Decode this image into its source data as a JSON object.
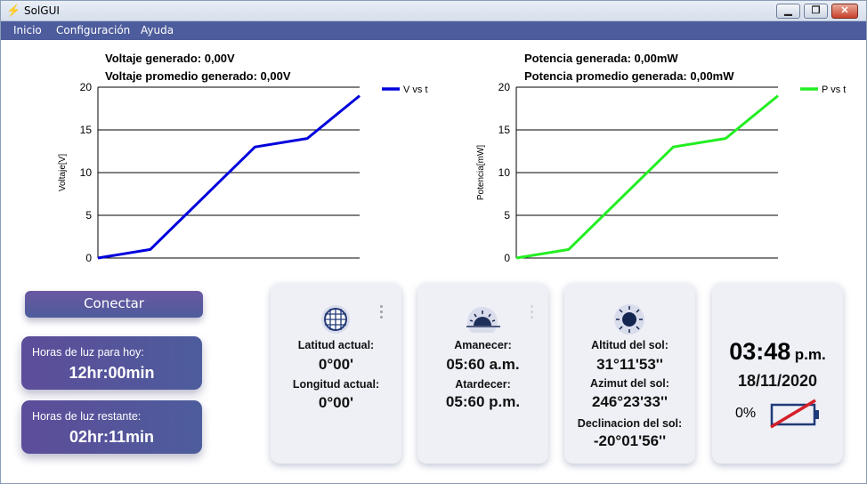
{
  "window": {
    "title": "SolGUI",
    "controls": {
      "minimize": "▁",
      "maximize": "❐",
      "close": "✕"
    }
  },
  "menu": [
    "Inicio",
    "Configuración",
    "Ayuda"
  ],
  "voltage": {
    "generated": "Voltaje generado: 0,00V",
    "average": "Voltaje promedio generado: 0,00V"
  },
  "power": {
    "generated": "Potencia generada: 0,00mW",
    "average": "Potencia promedio generada: 0,00mW"
  },
  "chart_data": [
    {
      "type": "line",
      "ylabel": "Voltaje[V]",
      "ylim": [
        0,
        20
      ],
      "yticks": [
        0,
        5,
        10,
        15,
        20
      ],
      "grid": true,
      "legend": "top-right",
      "series": [
        {
          "name": "V vs t",
          "color": "#0000dd",
          "x": [
            0,
            1,
            2,
            3,
            4,
            5
          ],
          "y": [
            0,
            1,
            7,
            13,
            14,
            19
          ]
        }
      ]
    },
    {
      "type": "line",
      "ylabel": "Potencia[mW]",
      "ylim": [
        0,
        20
      ],
      "yticks": [
        0,
        5,
        10,
        15,
        20
      ],
      "grid": true,
      "legend": "top-right",
      "series": [
        {
          "name": "P vs t",
          "color": "#22ee22",
          "x": [
            0,
            1,
            2,
            3,
            4,
            5
          ],
          "y": [
            0,
            1,
            7,
            13,
            14,
            19
          ]
        }
      ]
    }
  ],
  "controls": {
    "connect": "Conectar",
    "daylight_today_label": "Horas de luz para hoy:",
    "daylight_today_value": "12hr:00min",
    "daylight_left_label": "Horas de luz restante:",
    "daylight_left_value": "02hr:11min"
  },
  "location": {
    "lat_label": "Latitud actual:",
    "lat_value": "0°00'",
    "lon_label": "Longitud actual:",
    "lon_value": "0°00'"
  },
  "sun_times": {
    "sunrise_label": "Amanecer:",
    "sunrise_value": "05:60 a.m.",
    "sunset_label": "Atardecer:",
    "sunset_value": "05:60 p.m."
  },
  "sun_position": {
    "altitude_label": "Altitud del sol:",
    "altitude_value": "31°11'53''",
    "azimuth_label": "Azimut del sol:",
    "azimuth_value": "246°23'33''",
    "declination_label": "Declinacion del sol:",
    "declination_value": "-20°01'56''"
  },
  "clock": {
    "time": "03:48",
    "ampm": "p.m.",
    "date": "18/11/2020",
    "battery": "0%"
  },
  "colors": {
    "menu": "#4d5c9c",
    "card_gradient_start": "#5d4d9a",
    "battery_slash": "#d4202a"
  }
}
